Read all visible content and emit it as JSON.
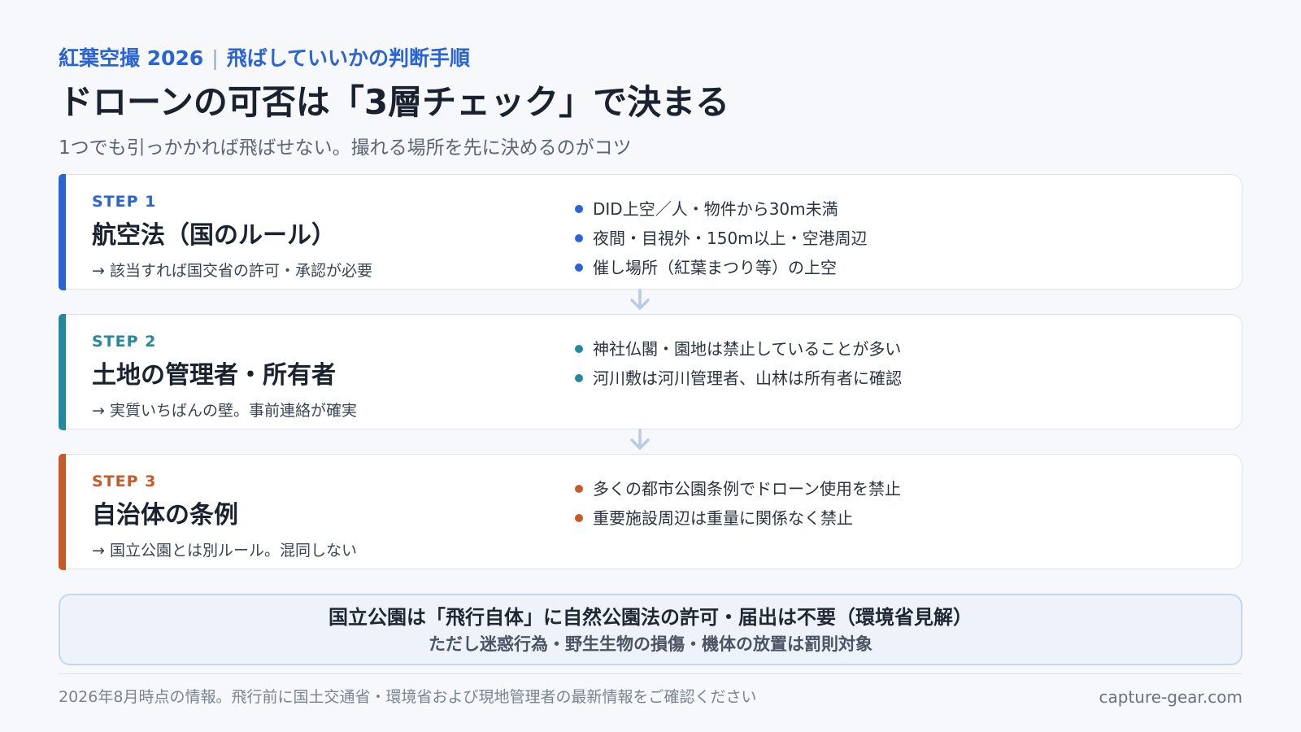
{
  "header": {
    "kicker_left": "紅葉空撮 2026",
    "kicker_sep": "|",
    "kicker_right": "飛ばしていいかの判断手順",
    "title": "ドローンの可否は「3層チェック」で決まる",
    "subtitle": "1つでも引っかかれば飛ばせない。撮れる場所を先に決めるのがコツ"
  },
  "steps": [
    {
      "label": "STEP 1",
      "heading": "航空法（国のルール）",
      "note": "→ 該当すれば国交省の許可・承認が必要",
      "points": [
        "DID上空／人・物件から30m未満",
        "夜間・目視外・150m以上・空港周辺",
        "催し場所（紅葉まつり等）の上空"
      ],
      "color": "#2a63d6"
    },
    {
      "label": "STEP 2",
      "heading": "土地の管理者・所有者",
      "note": "→ 実質いちばんの壁。事前連絡が確実",
      "points": [
        "神社仏閣・園地は禁止していることが多い",
        "河川敷は河川管理者、山林は所有者に確認"
      ],
      "color": "#24889e"
    },
    {
      "label": "STEP 3",
      "heading": "自治体の条例",
      "note": "→ 国立公園とは別ルール。混同しない",
      "points": [
        "多くの都市公園条例でドローン使用を禁止",
        "重要施設周辺は重量に関係なく禁止"
      ],
      "color": "#c85a2a"
    }
  ],
  "icons": {
    "step_arrow": "chevron-down-arrow-icon",
    "bullet": "dot-icon"
  },
  "callout": {
    "main": "国立公園は「飛行自体」に自然公園法の許可・届出は不要（環境省見解）",
    "sub": "ただし迷惑行為・野生生物の損傷・機体の放置は罰則対象"
  },
  "footer": {
    "note": "2026年8月時点の情報。飛行前に国土交通省・環境省および現地管理者の最新情報をご確認ください",
    "site": "capture-gear.com"
  }
}
